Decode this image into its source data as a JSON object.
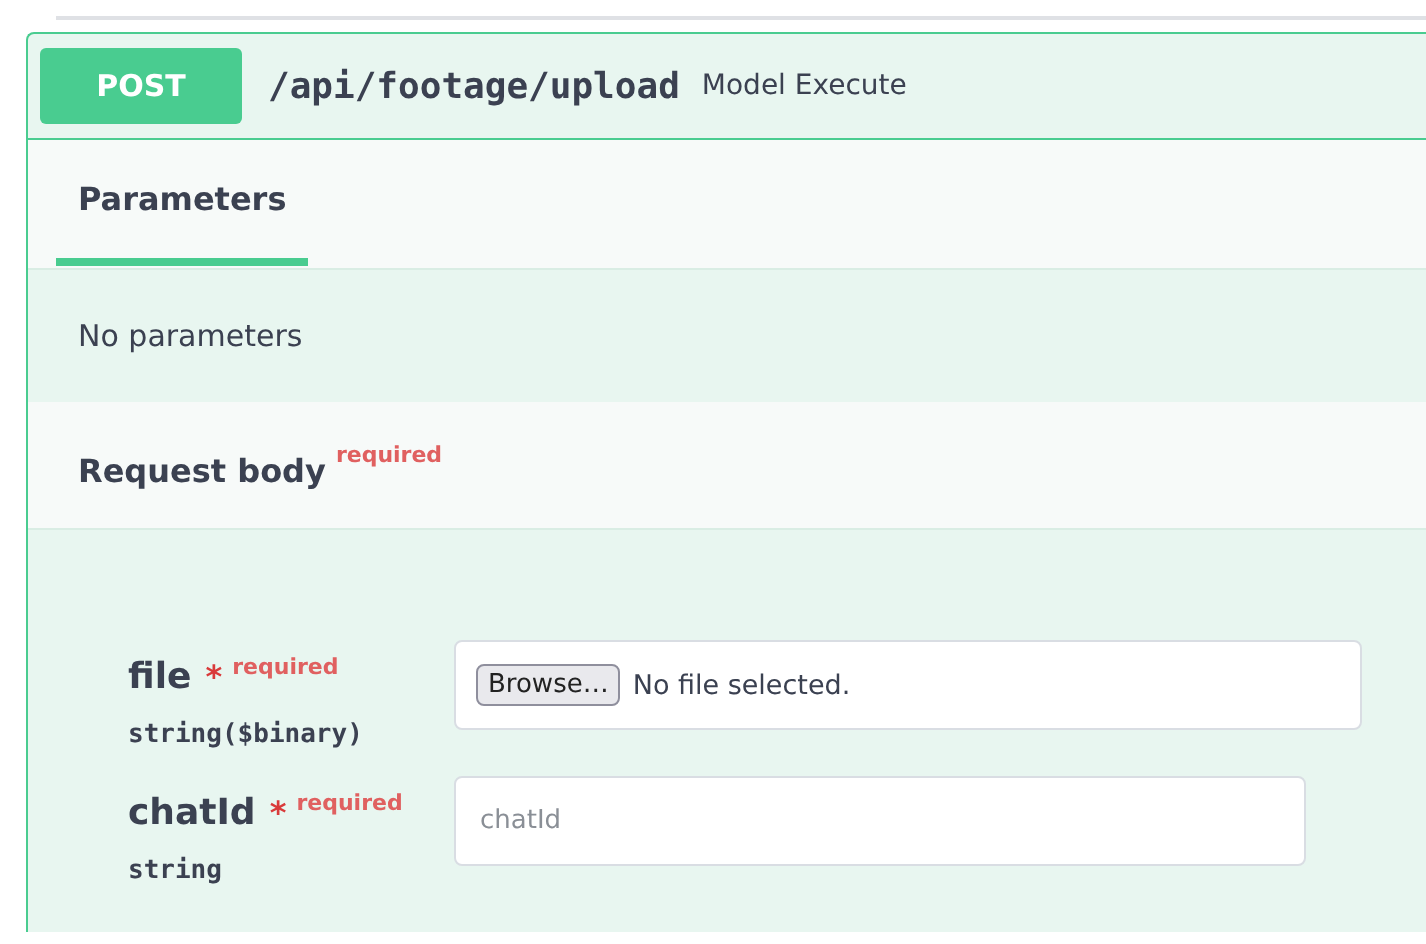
{
  "operation": {
    "method": "POST",
    "path": "/api/footage/upload",
    "summary": "Model Execute"
  },
  "tabs": [
    {
      "label": "Parameters",
      "selected": true
    }
  ],
  "parameters_message": "No parameters",
  "request_body": {
    "title": "Request body",
    "required_label": "required",
    "fields": [
      {
        "kind": "file",
        "name": "file",
        "required_mark": "*",
        "required_label": "required",
        "type": "string($binary)",
        "button": "Browse…",
        "status": "No file selected."
      },
      {
        "kind": "text",
        "name": "chatId",
        "required_mark": "*",
        "required_label": "required",
        "type": "string",
        "placeholder": "chatId"
      }
    ]
  }
}
